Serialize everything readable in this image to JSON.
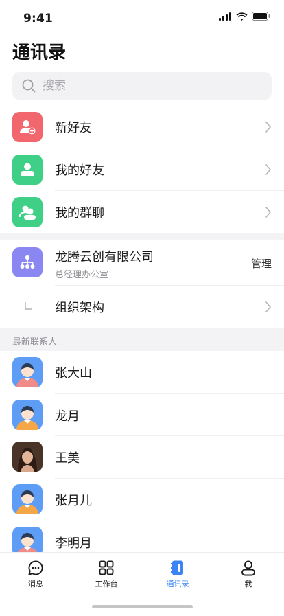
{
  "status": {
    "time": "9:41"
  },
  "page": {
    "title": "通讯录"
  },
  "search": {
    "placeholder": "搜索"
  },
  "menu": {
    "new_friends": "新好友",
    "my_friends": "我的好友",
    "my_groups": "我的群聊"
  },
  "company": {
    "name": "龙腾云创有限公司",
    "department": "总经理办公室",
    "manage_label": "管理",
    "org_label": "组织架构"
  },
  "recent": {
    "header": "最新联系人",
    "contacts": [
      {
        "name": "张大山"
      },
      {
        "name": "龙月"
      },
      {
        "name": "王美"
      },
      {
        "name": "张月儿"
      },
      {
        "name": "李明月"
      }
    ]
  },
  "tabbar": {
    "items": [
      {
        "label": "消息",
        "icon": "chat-icon"
      },
      {
        "label": "工作台",
        "icon": "grid-icon"
      },
      {
        "label": "通讯录",
        "icon": "contacts-book-icon",
        "active": true
      },
      {
        "label": "我",
        "icon": "person-icon"
      }
    ]
  },
  "colors": {
    "accent": "#3c83f6",
    "new_friends_bg": "#f2676d",
    "friends_bg": "#3fcf86",
    "groups_bg": "#3fcf86",
    "company_bg": "#8a86f2",
    "avatar_bg": "#5d9df5"
  }
}
